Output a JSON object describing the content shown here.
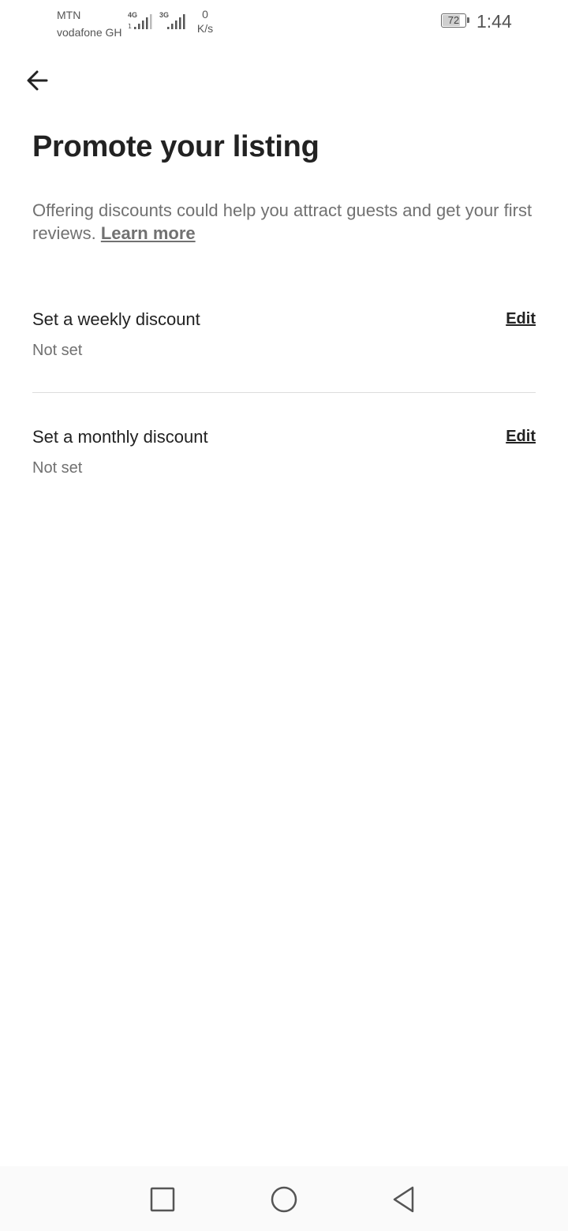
{
  "status_bar": {
    "carrier_1": "MTN",
    "carrier_2": "vodafone GH",
    "network_1": "4G",
    "network_2": "3G",
    "speed_value": "0",
    "speed_unit": "K/s",
    "battery_level": "72",
    "time": "1:44"
  },
  "header": {
    "back_icon": "arrow-left-icon"
  },
  "page": {
    "title": "Promote your listing",
    "description": "Offering discounts could help you attract guests and get your first reviews.",
    "learn_more": "Learn more"
  },
  "discounts": [
    {
      "title": "Set a weekly discount",
      "value": "Not set",
      "edit_label": "Edit"
    },
    {
      "title": "Set a monthly discount",
      "value": "Not set",
      "edit_label": "Edit"
    }
  ],
  "nav_bar": {
    "recents_icon": "square-icon",
    "home_icon": "circle-icon",
    "back_icon": "triangle-back-icon"
  },
  "colors": {
    "text_primary": "#222222",
    "text_secondary": "#717171",
    "divider": "#dddddd"
  }
}
